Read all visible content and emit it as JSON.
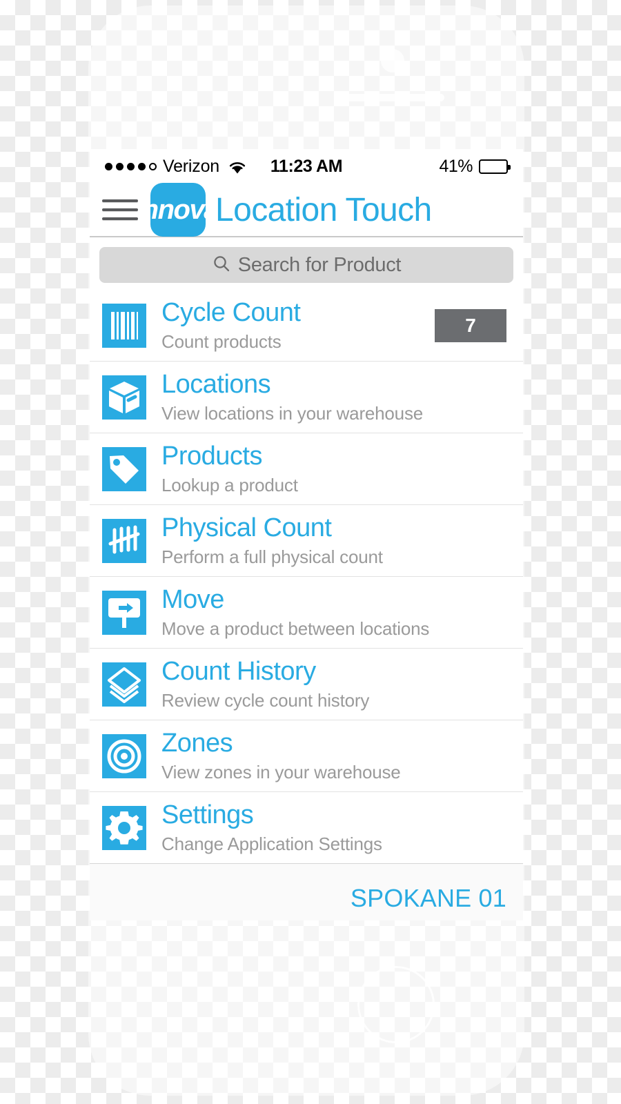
{
  "status_bar": {
    "signal_dots_filled": 4,
    "signal_dots_total": 5,
    "carrier": "Verizon",
    "wifi_icon": "wifi-icon",
    "time": "11:23 AM",
    "battery_percent": "41%",
    "battery_level": 41
  },
  "nav": {
    "menu_icon": "hamburger-menu-icon",
    "logo_text": "innova",
    "app_title": "Location Touch",
    "accent_color": "#29abe2"
  },
  "search": {
    "icon": "search-icon",
    "placeholder": "Search for Product",
    "value": ""
  },
  "menu": {
    "items": [
      {
        "icon": "barcode-icon",
        "title": "Cycle Count",
        "subtitle": "Count products",
        "badge": "7"
      },
      {
        "icon": "box-icon",
        "title": "Locations",
        "subtitle": "View locations in your warehouse",
        "badge": ""
      },
      {
        "icon": "tag-icon",
        "title": "Products",
        "subtitle": "Lookup a product",
        "badge": ""
      },
      {
        "icon": "tally-marks-icon",
        "title": "Physical Count",
        "subtitle": "Perform a full physical count",
        "badge": ""
      },
      {
        "icon": "sign-arrow-right-icon",
        "title": "Move",
        "subtitle": "Move a product between locations",
        "badge": ""
      },
      {
        "icon": "layers-icon",
        "title": "Count History",
        "subtitle": "Review cycle count history",
        "badge": ""
      },
      {
        "icon": "target-icon",
        "title": "Zones",
        "subtitle": "View zones in your warehouse",
        "badge": ""
      },
      {
        "icon": "gear-icon",
        "title": "Settings",
        "subtitle": "Change Application Settings",
        "badge": ""
      }
    ]
  },
  "footer": {
    "warehouse": "SPOKANE 01",
    "color": "#29abe2"
  },
  "colors": {
    "accent": "#29abe2",
    "badge_bg": "#6b6d70",
    "subtitle": "#9a9a9a",
    "search_bg": "#d8d8d8"
  }
}
